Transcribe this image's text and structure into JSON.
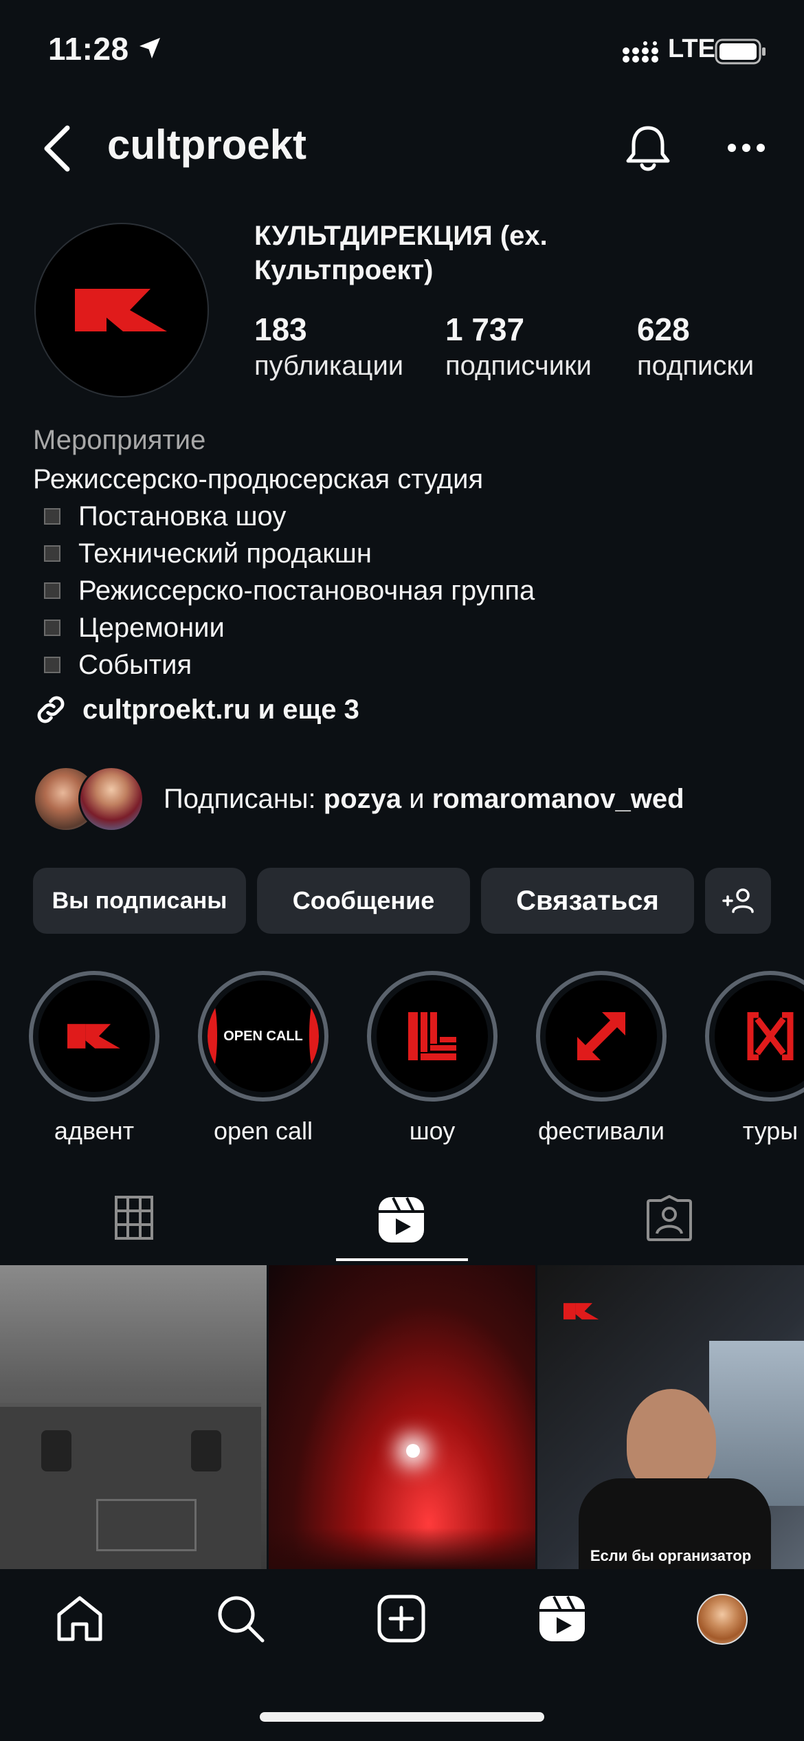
{
  "status_bar": {
    "time": "11:28",
    "network": "LTE"
  },
  "header": {
    "username": "cultproekt"
  },
  "profile": {
    "full_name": "КУЛЬТДИРЕКЦИЯ (ex. Культпроект)",
    "stats": [
      {
        "value": "183",
        "label": "публикации"
      },
      {
        "value": "1 737",
        "label": "подписчики"
      },
      {
        "value": "628",
        "label": "подписки"
      }
    ],
    "category": "Мероприятие",
    "bio_title": "Режиссерско-продюсерская студия",
    "bio_items": [
      "Постановка шоу",
      "Технический продакшн",
      "Режиссерско-постановочная группа",
      "Церемонии",
      "События"
    ],
    "link_text": "cultproekt.ru и еще 3",
    "followed_by": {
      "prefix": "Подписаны: ",
      "user1": "pozya",
      "conj": " и ",
      "user2": "romaromanov_wed"
    }
  },
  "buttons": {
    "subscribed": "Вы подписаны",
    "message": "Сообщение",
    "contact": "Связаться"
  },
  "highlights": [
    {
      "label": "адвент"
    },
    {
      "label": "open call",
      "cover_text": "OPEN CALL"
    },
    {
      "label": "шоу"
    },
    {
      "label": "фестивали"
    },
    {
      "label": "туры"
    }
  ],
  "posts": [
    {
      "caption": ""
    },
    {
      "caption": ""
    },
    {
      "caption": "Если бы организатор"
    }
  ],
  "colors": {
    "background": "#0c1014",
    "brand_red": "#e01b1b",
    "button": "#262a30"
  }
}
